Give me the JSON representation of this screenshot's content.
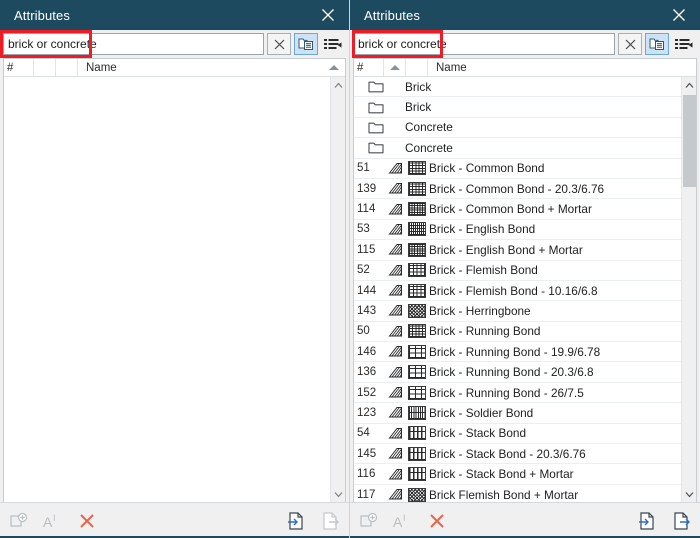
{
  "panels": [
    {
      "title": "Attributes",
      "close_icon": "close-icon",
      "search": {
        "value": "brick or concrete",
        "placeholder": "",
        "clear_icon": "clear-x-icon",
        "folder_view_icon": "folder-view-icon",
        "list_view_icon": "list-view-icon"
      },
      "columns": [
        "#",
        "",
        "",
        "Name"
      ],
      "rows": [],
      "bottom_toolbar": {
        "new_icon": "new-attribute-icon",
        "rename_icon": "rename-text-icon",
        "delete_icon": "delete-x-icon",
        "import_icon": "import-file-icon",
        "export_icon": "export-file-icon"
      }
    },
    {
      "title": "Attributes",
      "close_icon": "close-icon",
      "search": {
        "value": "brick or concrete",
        "placeholder": "",
        "clear_icon": "clear-x-icon",
        "folder_view_icon": "folder-view-icon",
        "list_view_icon": "list-view-icon"
      },
      "columns": [
        "#",
        "",
        "",
        "Name"
      ],
      "rows": [
        {
          "num": "",
          "type": "folder",
          "name": "Brick"
        },
        {
          "num": "",
          "type": "folder",
          "name": "Brick"
        },
        {
          "num": "",
          "type": "folder",
          "name": "Concrete"
        },
        {
          "num": "",
          "type": "folder",
          "name": "Concrete"
        },
        {
          "num": "51",
          "type": "pattern",
          "swatch": "common",
          "name": "Brick - Common Bond"
        },
        {
          "num": "139",
          "type": "pattern",
          "swatch": "common",
          "name": "Brick - Common Bond - 20.3/6.76"
        },
        {
          "num": "114",
          "type": "pattern",
          "swatch": "dense",
          "name": "Brick - Common Bond + Mortar"
        },
        {
          "num": "53",
          "type": "pattern",
          "swatch": "english",
          "name": "Brick - English Bond"
        },
        {
          "num": "115",
          "type": "pattern",
          "swatch": "dense",
          "name": "Brick - English Bond + Mortar"
        },
        {
          "num": "52",
          "type": "pattern",
          "swatch": "flemish",
          "name": "Brick - Flemish Bond"
        },
        {
          "num": "144",
          "type": "pattern",
          "swatch": "flemish",
          "name": "Brick - Flemish Bond - 10.16/6.8"
        },
        {
          "num": "143",
          "type": "pattern",
          "swatch": "herring",
          "name": "Brick - Herringbone"
        },
        {
          "num": "50",
          "type": "pattern",
          "swatch": "common",
          "name": "Brick - Running Bond"
        },
        {
          "num": "146",
          "type": "pattern",
          "swatch": "running",
          "name": "Brick - Running Bond - 19.9/6.78"
        },
        {
          "num": "136",
          "type": "pattern",
          "swatch": "running",
          "name": "Brick - Running Bond - 20.3/6.8"
        },
        {
          "num": "152",
          "type": "pattern",
          "swatch": "running",
          "name": "Brick - Running Bond - 26/7.5"
        },
        {
          "num": "123",
          "type": "pattern",
          "swatch": "soldier",
          "name": "Brick - Soldier Bond"
        },
        {
          "num": "54",
          "type": "pattern",
          "swatch": "stack",
          "name": "Brick - Stack Bond"
        },
        {
          "num": "145",
          "type": "pattern",
          "swatch": "stack",
          "name": "Brick - Stack Bond - 20.3/6.76"
        },
        {
          "num": "116",
          "type": "pattern",
          "swatch": "stack",
          "name": "Brick - Stack Bond + Mortar"
        },
        {
          "num": "117",
          "type": "pattern",
          "swatch": "herring",
          "name": "Brick Flemish Bond + Mortar"
        }
      ],
      "bottom_toolbar": {
        "new_icon": "new-attribute-icon",
        "rename_icon": "rename-text-icon",
        "delete_icon": "delete-x-icon",
        "import_icon": "import-file-icon",
        "export_icon": "export-file-icon"
      }
    }
  ],
  "colors": {
    "titlebar": "#1e4a60",
    "annotation": "#ee1c25",
    "accent_blue": "#2f6fbf",
    "delete_red": "#e8644c",
    "panel_bg": "#f0f0f0"
  }
}
